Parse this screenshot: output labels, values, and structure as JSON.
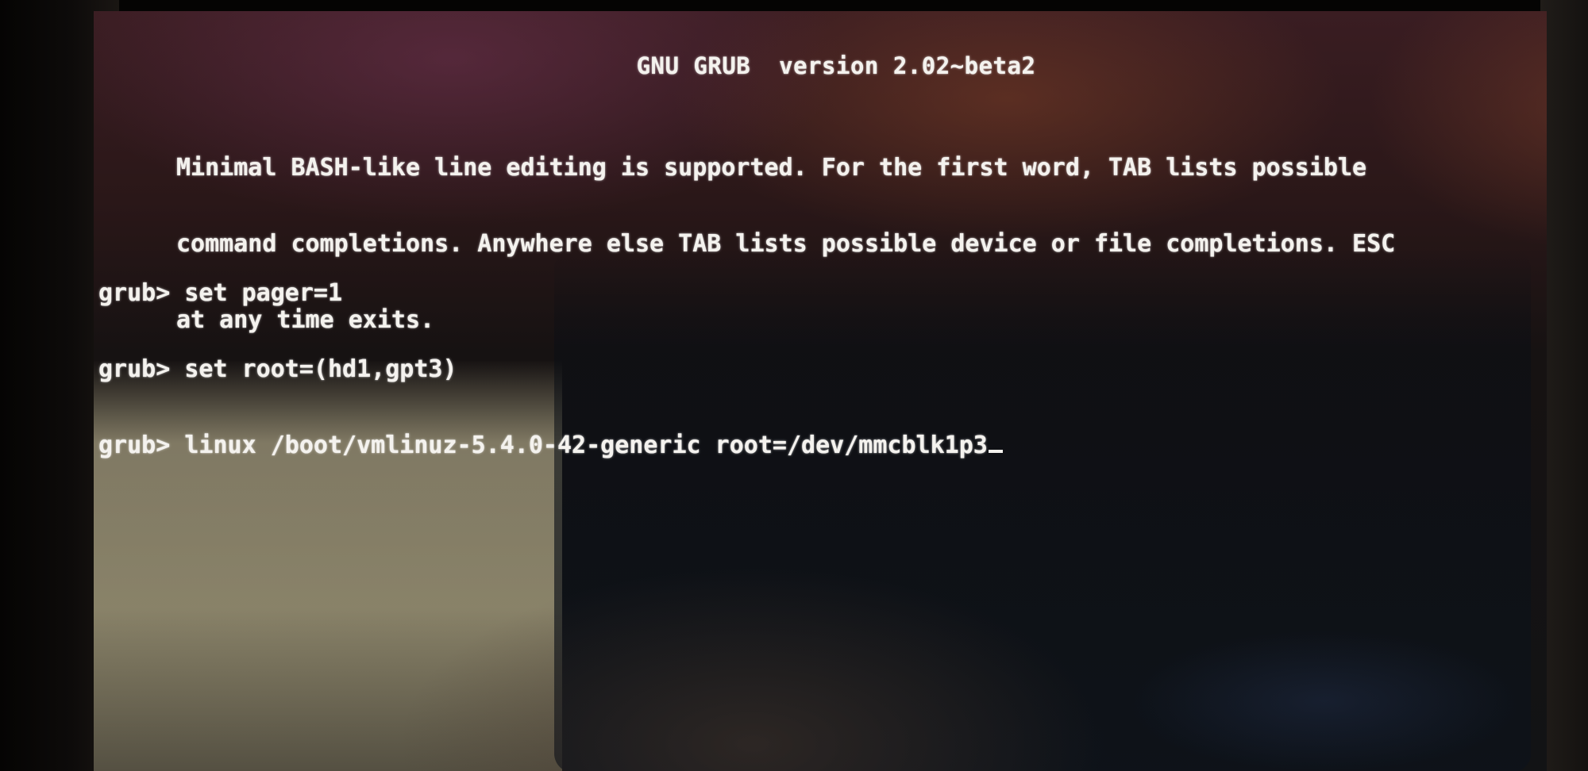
{
  "grub": {
    "header": "GNU GRUB  version 2.02~beta2",
    "help_lines": [
      "Minimal BASH-like line editing is supported. For the first word, TAB lists possible",
      "command completions. Anywhere else TAB lists possible device or file completions. ESC",
      "at any time exits."
    ],
    "prompt": "grub> ",
    "commands": [
      "set pager=1",
      "set root=(hd1,gpt3)",
      "linux /boot/vmlinuz-5.4.0-42-generic root=/dev/mmcblk1p3"
    ]
  },
  "colors": {
    "text": "#f4f2ee",
    "background": "#161212"
  }
}
